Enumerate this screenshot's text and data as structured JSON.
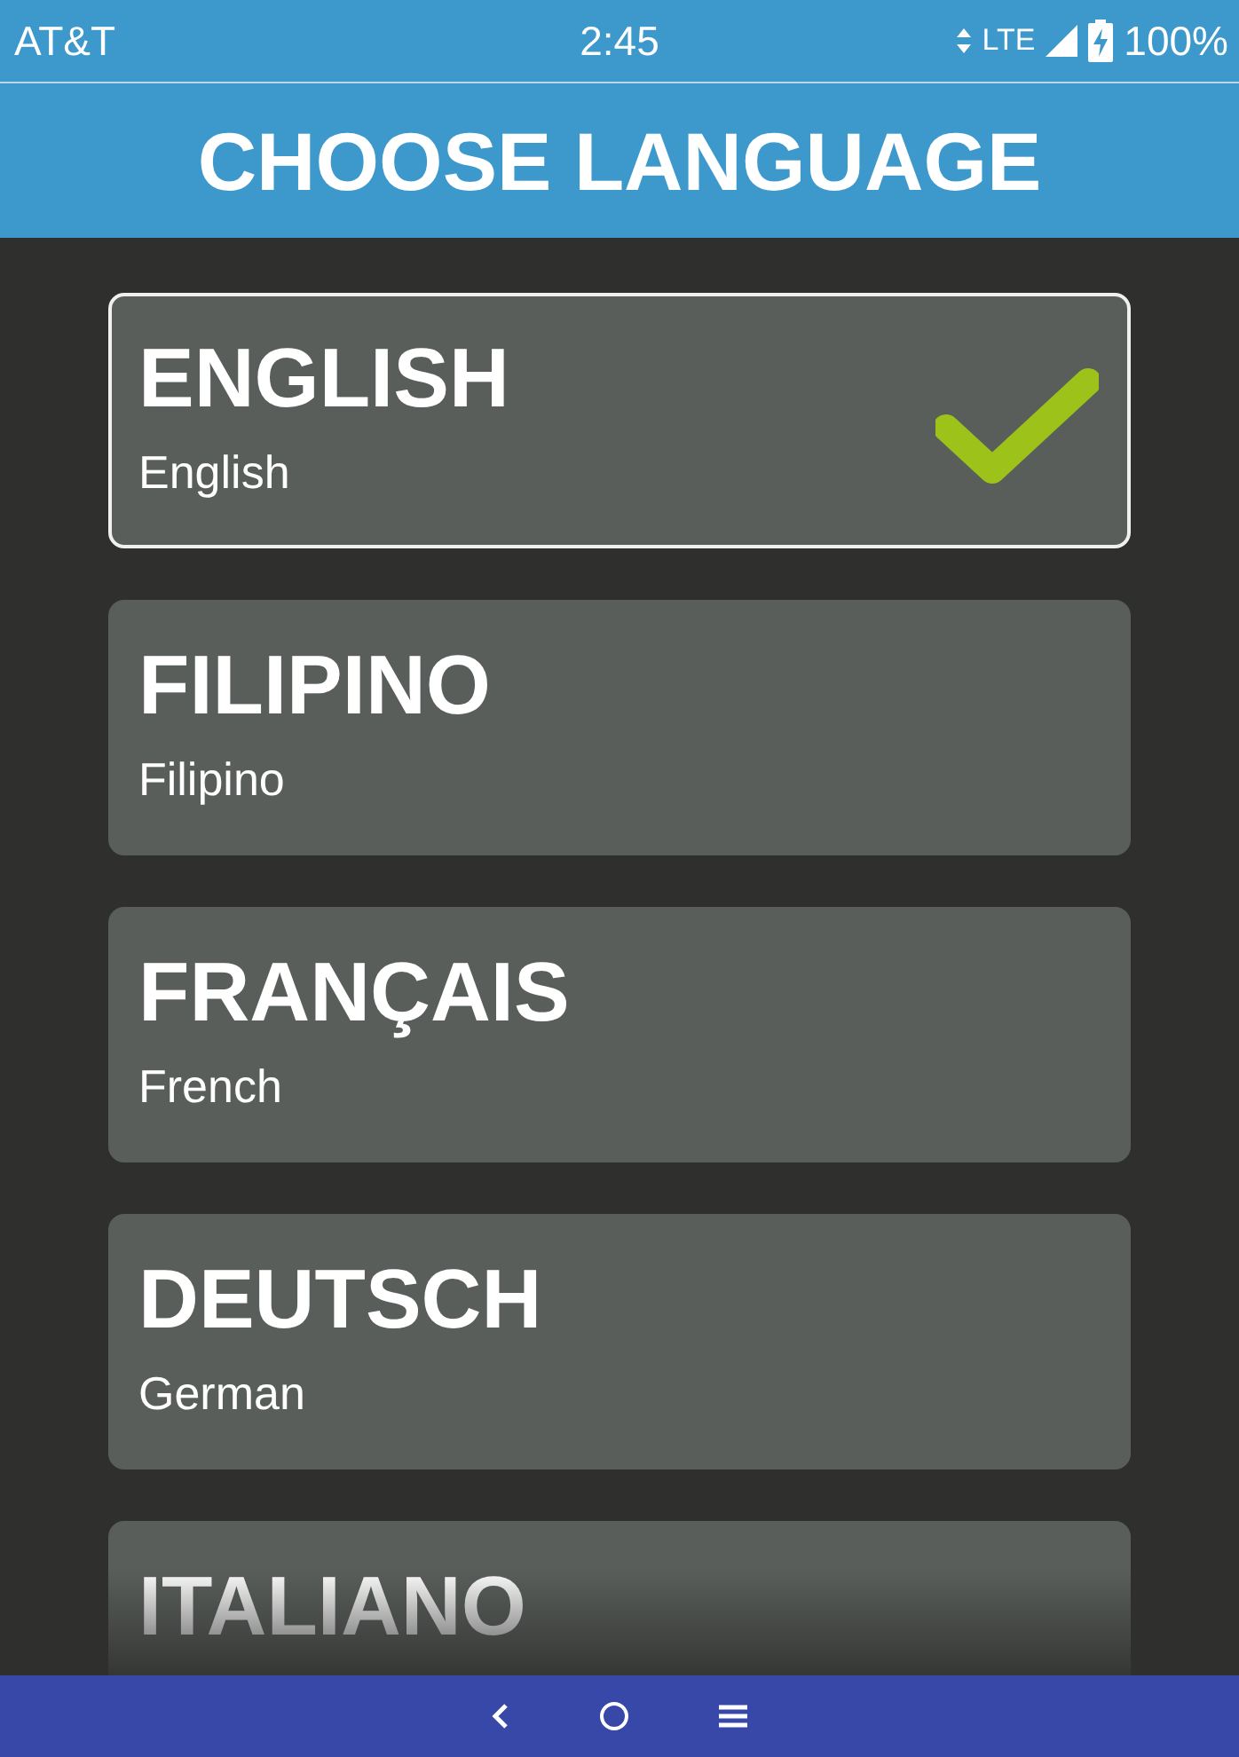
{
  "status_bar": {
    "carrier": "AT&T",
    "time": "2:45",
    "network": "LTE",
    "battery": "100%"
  },
  "header": {
    "title": "CHOOSE LANGUAGE"
  },
  "languages": [
    {
      "name": "ENGLISH",
      "subtitle": "English",
      "selected": true
    },
    {
      "name": "FILIPINO",
      "subtitle": "Filipino",
      "selected": false
    },
    {
      "name": "FRANÇAIS",
      "subtitle": "French",
      "selected": false
    },
    {
      "name": "DEUTSCH",
      "subtitle": "German",
      "selected": false
    },
    {
      "name": "ITALIANO",
      "selected": false
    }
  ]
}
